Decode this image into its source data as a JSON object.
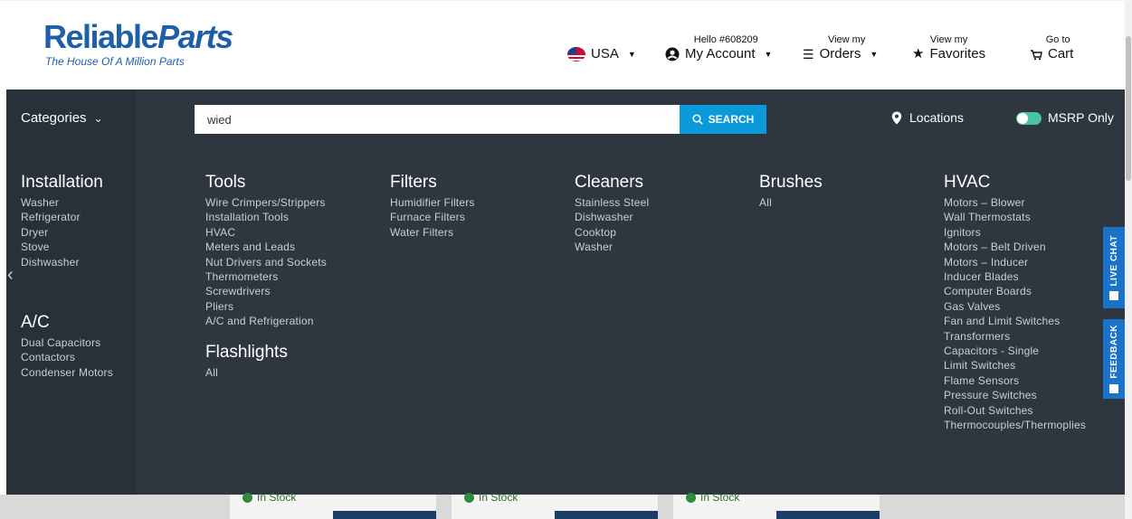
{
  "header": {
    "logo_part1": "Reliable",
    "logo_part2": "Parts",
    "tagline": "The House Of A Million Parts",
    "country": "USA",
    "greeting": "Hello #608209",
    "account": "My Account",
    "orders_small": "View my",
    "orders": "Orders",
    "favorites_small": "View my",
    "favorites": "Favorites",
    "cart_small": "Go to",
    "cart": "Cart"
  },
  "nav": {
    "categories": "Categories",
    "search_value": "wied",
    "search_button": "SEARCH",
    "locations": "Locations",
    "msrp": "MSRP Only"
  },
  "menu": {
    "installation": {
      "title": "Installation",
      "items": [
        "Washer",
        "Refrigerator",
        "Dryer",
        "Stove",
        "Dishwasher"
      ]
    },
    "ac": {
      "title": "A/C",
      "items": [
        "Dual Capacitors",
        "Contactors",
        "Condenser Motors"
      ]
    },
    "tools": {
      "title": "Tools",
      "items": [
        "Wire Crimpers/Strippers",
        "Installation Tools",
        "HVAC",
        "Meters and Leads",
        "Nut Drivers and Sockets",
        "Thermometers",
        "Screwdrivers",
        "Pliers",
        "A/C and Refrigeration"
      ]
    },
    "flashlights": {
      "title": "Flashlights",
      "items": [
        "All"
      ]
    },
    "filters": {
      "title": "Filters",
      "items": [
        "Humidifier Filters",
        "Furnace Filters",
        "Water Filters"
      ]
    },
    "cleaners": {
      "title": "Cleaners",
      "items": [
        "Stainless Steel",
        "Dishwasher",
        "Cooktop",
        "Washer"
      ]
    },
    "brushes": {
      "title": "Brushes",
      "items": [
        "All"
      ]
    },
    "hvac": {
      "title": "HVAC",
      "items": [
        "Motors – Blower",
        "Wall Thermostats",
        "Ignitors",
        "Motors – Belt Driven",
        "Motors – Inducer",
        "Inducer Blades",
        "Computer Boards",
        "Gas Valves",
        "Fan and Limit Switches",
        "Transformers",
        "Capacitors - Single",
        "Limit Switches",
        "Flame Sensors",
        "Pressure Switches",
        "Roll-Out Switches",
        "Thermocouples/Thermoplies"
      ]
    }
  },
  "side_tabs": {
    "live_chat": "LIVE CHAT",
    "feedback": "FEEDBACK"
  },
  "products": {
    "stock_label": "In Stock"
  },
  "colors": {
    "nav_bg": "#2e3640",
    "search_btn": "#0a9ad9",
    "brand": "#1f5fa8",
    "side_tab": "#1a73c8"
  }
}
